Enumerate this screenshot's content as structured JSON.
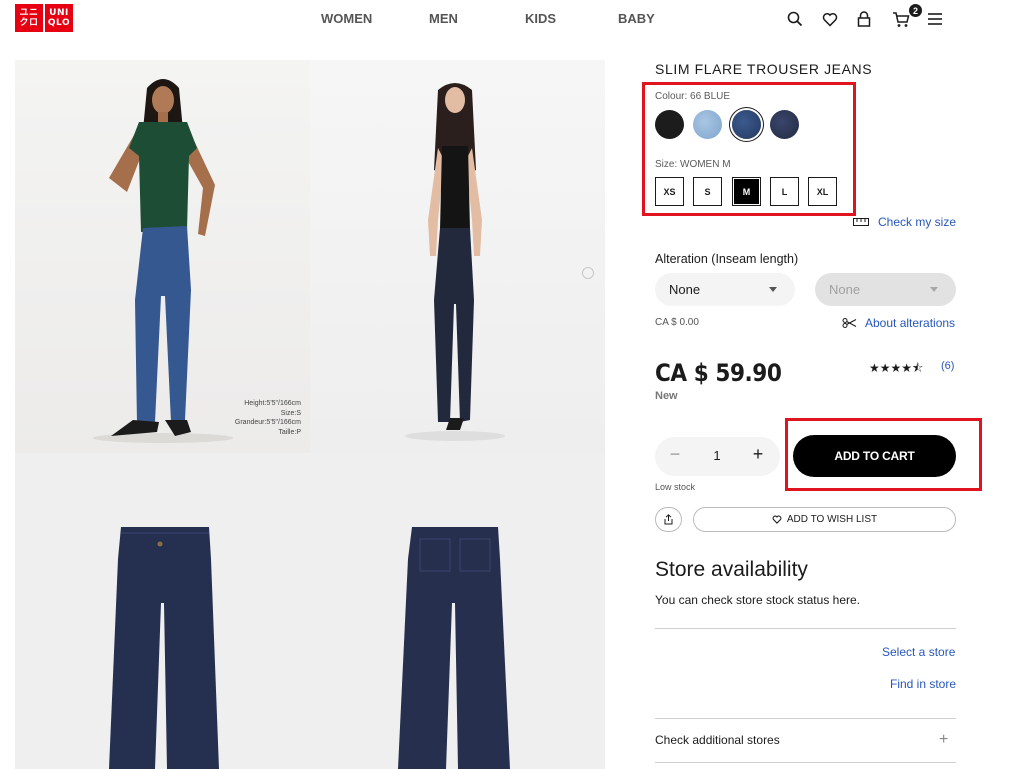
{
  "header": {
    "logo_top": "ユニクロ",
    "logo_bottom": "UNIQLO",
    "logo_box1": [
      "ユニ",
      "クロ"
    ],
    "logo_box2": [
      "UNI",
      "QLO"
    ],
    "nav": [
      "WOMEN",
      "MEN",
      "KIDS",
      "BABY"
    ],
    "icons": [
      "search-icon",
      "heart-icon",
      "account-icon",
      "cart-icon",
      "menu-icon"
    ],
    "cart_count": "2"
  },
  "gallery": {
    "model_info": [
      "Height:5'5\"/166cm",
      "Size:S",
      "Grandeur:5'5\"/166cm",
      "Taille:P"
    ]
  },
  "product": {
    "title": "SLIM FLARE TROUSER JEANS",
    "colour_label": "Colour: 66 BLUE",
    "colours": [
      {
        "name": "black",
        "hex": "#1c1c1c"
      },
      {
        "name": "light-blue",
        "hex": "#8fb2d6"
      },
      {
        "name": "blue",
        "hex": "#2e4775"
      },
      {
        "name": "navy",
        "hex": "#2b3551"
      }
    ],
    "size_label": "Size: WOMEN M",
    "sizes": [
      "XS",
      "S",
      "M",
      "L",
      "XL"
    ],
    "selected_size": "M",
    "check_size": "Check my size",
    "alteration_label": "Alteration (Inseam length)",
    "alteration_value": "None",
    "alteration_value_2": "None",
    "alteration_price": "CA $ 0.00",
    "about_alterations": "About alterations",
    "price": "CA $ 59.90",
    "price_note": "New",
    "rating_stars": "★★★★⯪",
    "review_count": "(6)",
    "quantity": "1",
    "minus": "−",
    "plus": "+",
    "add_to_cart": "ADD TO CART",
    "low_stock": "Low stock",
    "wishlist": "ADD TO WISH LIST"
  },
  "store": {
    "title": "Store availability",
    "description": "You can check store stock status here.",
    "select_store": "Select a store",
    "find_in_store": "Find in store",
    "additional": "Check additional stores",
    "additional_icon": "+"
  },
  "colors": {
    "brand_red": "#e60012",
    "highlight_red": "#e0141e",
    "link_blue": "#2757ba"
  }
}
